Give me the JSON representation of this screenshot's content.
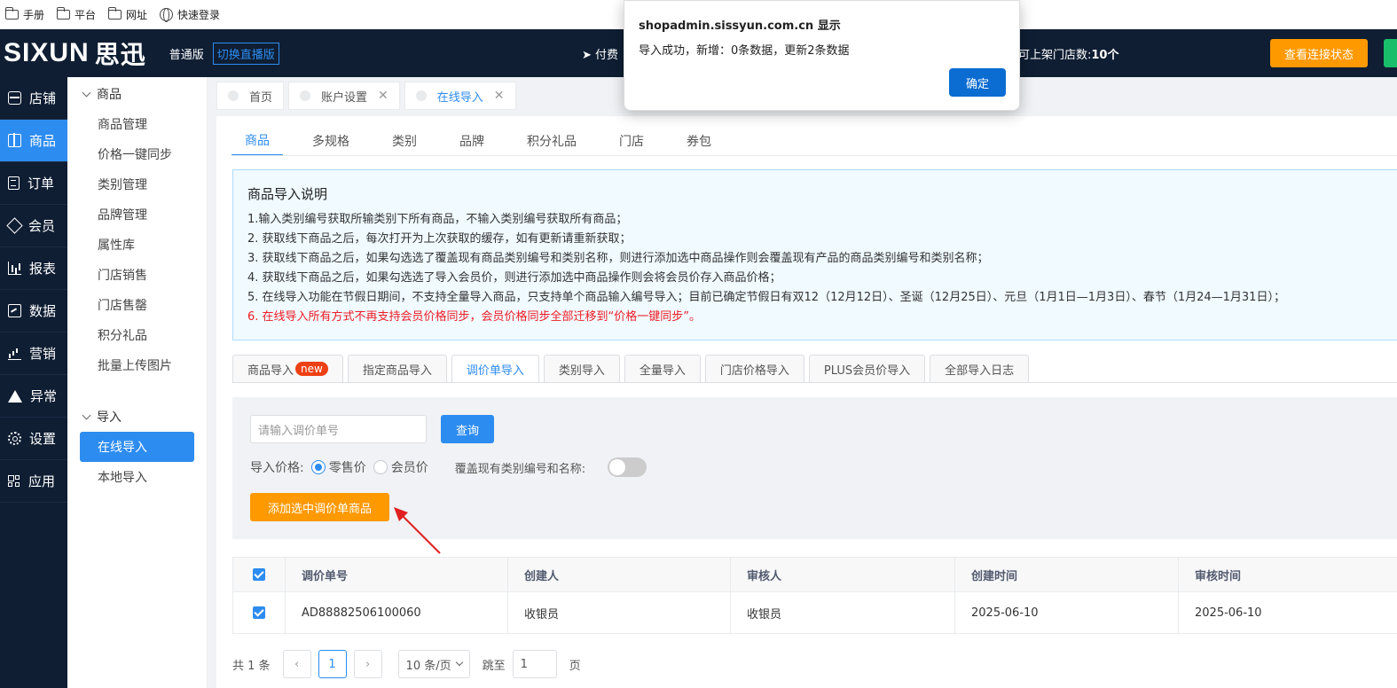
{
  "bookmarks": [
    {
      "label": "手册",
      "icon": "folder-icon"
    },
    {
      "label": "平台",
      "icon": "folder-icon"
    },
    {
      "label": "网址",
      "icon": "folder-icon"
    },
    {
      "label": "快速登录",
      "icon": "globe-icon"
    }
  ],
  "header": {
    "logo_en": "SIXUN",
    "logo_cn": "思迅",
    "edition": "普通版",
    "switch_live": "切换直播版",
    "paid": "付费",
    "store_count_label": "可上架门店数:",
    "store_count_value": "10个",
    "conn_button": "查看连接状态"
  },
  "leftnav": [
    {
      "label": "店铺",
      "icon": "store-icon"
    },
    {
      "label": "商品",
      "icon": "gift-icon",
      "active": true
    },
    {
      "label": "订单",
      "icon": "order-icon"
    },
    {
      "label": "会员",
      "icon": "member-icon"
    },
    {
      "label": "报表",
      "icon": "report-icon"
    },
    {
      "label": "数据",
      "icon": "data-icon"
    },
    {
      "label": "营销",
      "icon": "marketing-icon"
    },
    {
      "label": "异常",
      "icon": "warning-icon"
    },
    {
      "label": "设置",
      "icon": "gear-icon"
    },
    {
      "label": "应用",
      "icon": "apps-icon"
    }
  ],
  "subnav": {
    "group1": "商品",
    "items1": [
      "商品管理",
      "价格一键同步",
      "类别管理",
      "品牌管理",
      "属性库",
      "门店销售",
      "门店售罄",
      "积分礼品",
      "批量上传图片"
    ],
    "group2": "导入",
    "items2": [
      "在线导入",
      "本地导入"
    ]
  },
  "tabs": [
    {
      "label": "首页",
      "closable": false
    },
    {
      "label": "账户设置",
      "closable": true
    },
    {
      "label": "在线导入",
      "closable": true,
      "active": true
    }
  ],
  "category_tabs": [
    "商品",
    "多规格",
    "类别",
    "品牌",
    "积分礼品",
    "门店",
    "券包"
  ],
  "notice": {
    "title": "商品导入说明",
    "lines": [
      "1.输入类别编号获取所输类别下所有商品，不输入类别编号获取所有商品；",
      "2. 获取线下商品之后，每次打开为上次获取的缓存，如有更新请重新获取；",
      "3. 获取线下商品之后，如果勾选选了覆盖现有商品类别编号和类别名称，则进行添加选中商品操作则会覆盖现有产品的商品类别编号和类别名称；",
      "4. 获取线下商品之后，如果勾选选了导入会员价，则进行添加选中商品操作则会将会员价存入商品价格；",
      "5. 在线导入功能在节假日期间，不支持全量导入商品，只支持单个商品输入编号导入；目前已确定节假日有双12（12月12日）、圣诞（12月25日）、元旦（1月1日—1月3日）、春节（1月24—1月31日）；"
    ],
    "red_line": "6. 在线导入所有方式不再支持会员价格同步，会员价格同步全部迁移到“价格一键同步”。"
  },
  "import_tabs": [
    {
      "label": "商品导入",
      "badge": "new"
    },
    {
      "label": "指定商品导入"
    },
    {
      "label": "调价单导入",
      "active": true
    },
    {
      "label": "类别导入"
    },
    {
      "label": "全量导入"
    },
    {
      "label": "门店价格导入"
    },
    {
      "label": "PLUS会员价导入"
    },
    {
      "label": "全部导入日志"
    }
  ],
  "query": {
    "placeholder": "请输入调价单号",
    "button": "查询",
    "price_label": "导入价格:",
    "option_retail": "零售价",
    "option_member": "会员价",
    "selected": "零售价",
    "overwrite_label": "覆盖现有类别编号和名称:",
    "overwrite_on": false,
    "add_button": "添加选中调价单商品"
  },
  "table": {
    "columns": [
      "调价单号",
      "创建人",
      "审核人",
      "创建时间",
      "审核时间"
    ],
    "rows": [
      {
        "checked": true,
        "cells": [
          "AD88882506100060",
          "收银员",
          "收银员",
          "2025-06-10",
          "2025-06-10"
        ]
      }
    ]
  },
  "pager": {
    "total": "共 1 条",
    "current": "1",
    "size": "10 条/页",
    "jump_label": "跳至",
    "jump_value": "1",
    "page_suffix": "页"
  },
  "dialog": {
    "title": "shopadmin.sissyun.com.cn 显示",
    "message": "导入成功，新增：0条数据，更新2条数据",
    "ok": "确定"
  },
  "colors": {
    "primary": "#2d8cf0",
    "nav_bg": "#0f1e33",
    "orange": "#ff9900",
    "red": "#ed1c24"
  }
}
